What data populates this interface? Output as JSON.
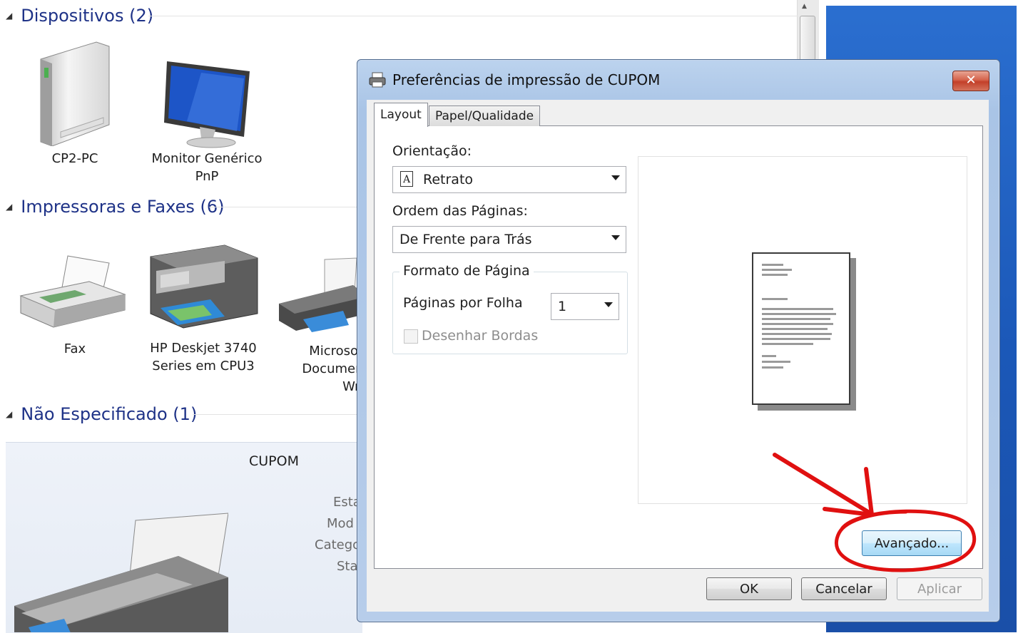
{
  "explorer": {
    "groups": {
      "devices": "Dispositivos (2)",
      "printers": "Impressoras e Faxes (6)",
      "unspecified": "Não Especificado (1)"
    },
    "devices": [
      {
        "label": "CP2-PC"
      },
      {
        "label": "Monitor Genérico\nPnP"
      }
    ],
    "printers": [
      {
        "label": "Fax"
      },
      {
        "label": "HP Deskjet 3740\nSeries em CPU3"
      },
      {
        "label": "Microsoft O\nDocument Ir\nWriter"
      }
    ],
    "detail": {
      "title": "CUPOM",
      "props": [
        "Esta",
        "Mod",
        "Catego",
        "Sta"
      ]
    }
  },
  "dialog": {
    "title": "Preferências de impressão de CUPOM",
    "close": "✕",
    "tabs": [
      "Layout",
      "Papel/Qualidade"
    ],
    "orientation": {
      "label": "Orientação:",
      "value": "Retrato",
      "icon": "A"
    },
    "page_order": {
      "label": "Ordem das Páginas:",
      "value": "De Frente para Trás"
    },
    "page_format": {
      "title": "Formato de Página",
      "pages_per_sheet_label": "Páginas por Folha",
      "pages_per_sheet_value": "1",
      "draw_borders_label": "Desenhar Bordas",
      "draw_borders_checked": false
    },
    "buttons": {
      "advanced": "Avançado...",
      "ok": "OK",
      "cancel": "Cancelar",
      "apply": "Aplicar"
    }
  },
  "colors": {
    "annotation": "#e01010",
    "desktop": "#1b58b8",
    "group_header": "#1e3287"
  }
}
